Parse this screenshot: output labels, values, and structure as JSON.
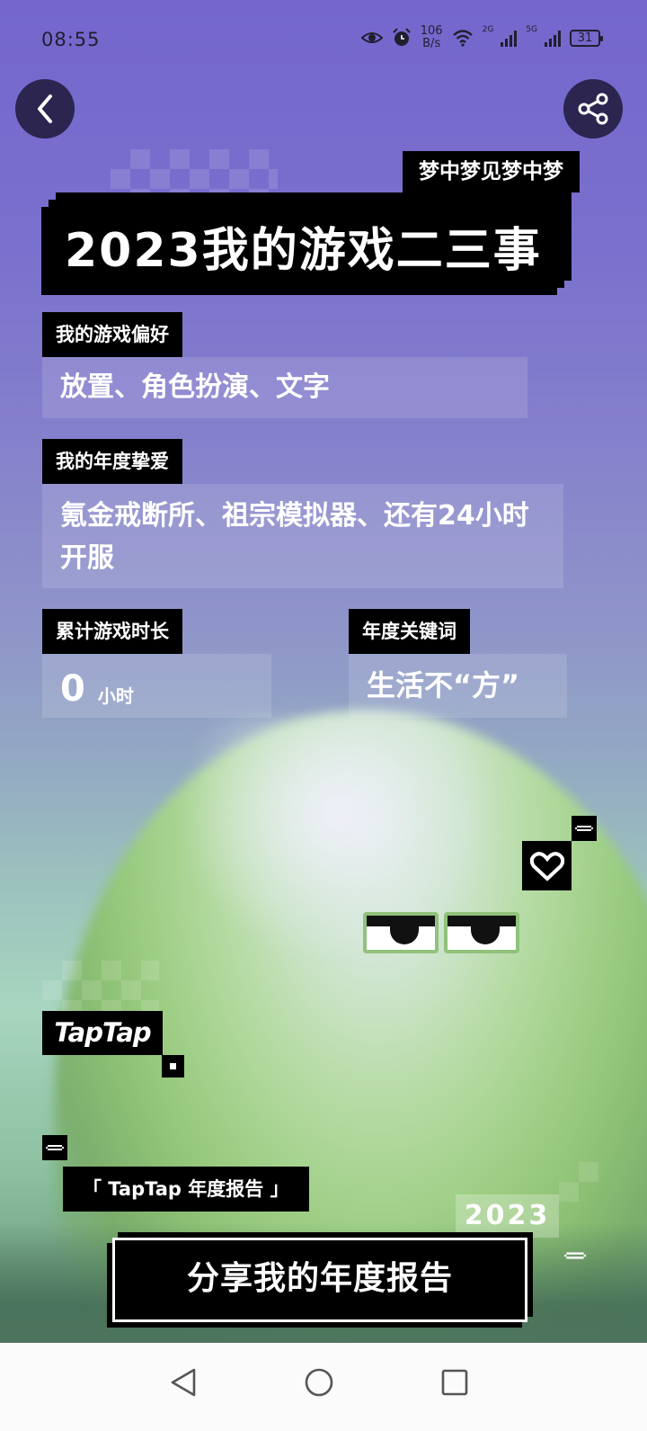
{
  "status_bar": {
    "time": "08:55",
    "net_speed_value": "106",
    "net_speed_unit": "B/s",
    "signal1_tag": "2G",
    "signal2_tag": "5G",
    "battery": "31"
  },
  "header": {
    "subtitle": "梦中梦见梦中梦",
    "title": "2023我的游戏二三事"
  },
  "stats": {
    "preference_label": "我的游戏偏好",
    "preference_value": "放置、角色扮演、文字",
    "favorite_label": "我的年度挚爱",
    "favorite_value": "氪金戒断所、祖宗模拟器、还有24小时开服",
    "playtime_label": "累计游戏时长",
    "playtime_value": "0",
    "playtime_unit": "小时",
    "keyword_label": "年度关键词",
    "keyword_value": "生活不“方”"
  },
  "branding": {
    "logo": "TapTap",
    "report_tag": "「 TapTap 年度报告 」",
    "year": "2023"
  },
  "cta": {
    "share_label": "分享我的年度报告"
  },
  "icons": {
    "back": "chevron-left-icon",
    "share": "share-icon",
    "heart": "heart-icon"
  },
  "colors": {
    "background_top": "#7466cd",
    "background_mid": "#93a9c3",
    "creature_green": "#9fcf86",
    "label_bg": "#000000",
    "button_circle": "#2b2550"
  }
}
